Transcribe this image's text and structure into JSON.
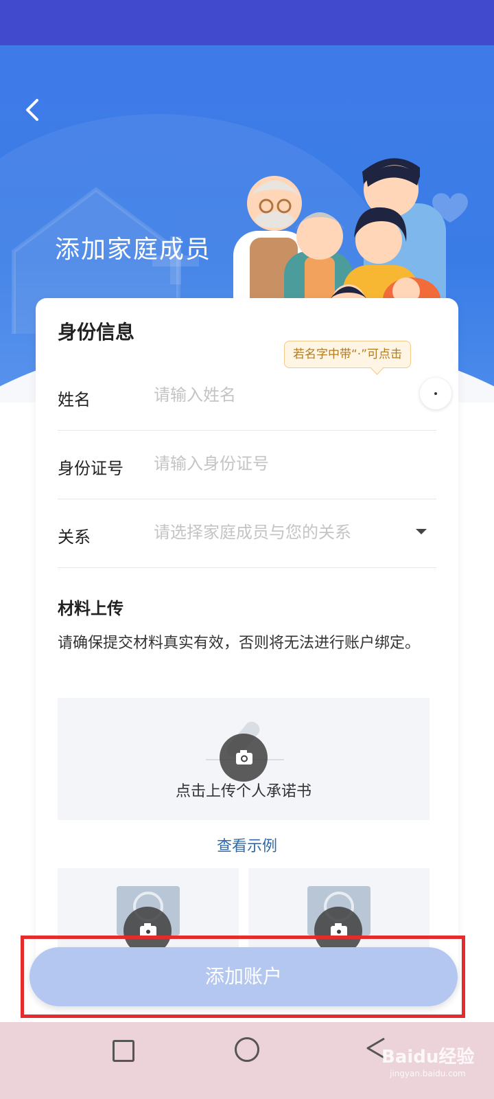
{
  "header": {
    "title": "添加家庭成员"
  },
  "form": {
    "section_title": "身份信息",
    "tooltip": "若名字中带“·”可点击",
    "name": {
      "label": "姓名",
      "placeholder": "请输入姓名"
    },
    "id_number": {
      "label": "身份证号",
      "placeholder": "请输入身份证号"
    },
    "relation": {
      "label": "关系",
      "placeholder": "请选择家庭成员与您的关系"
    }
  },
  "materials": {
    "section_title": "材料上传",
    "note": "请确保提交材料真实有效，否则将无法进行账户绑定。",
    "upload_label": "点击上传个人承诺书",
    "example_link": "查看示例"
  },
  "submit": {
    "label": "添加账户"
  },
  "watermark": {
    "brand": "Baidu经验",
    "url": "jingyan.baidu.com"
  },
  "colors": {
    "status_bar": "#4149cd",
    "hero_blue": "#3f7be8",
    "submit_disabled": "#b4c7f0",
    "highlight_border": "#e42c2c",
    "tooltip_text": "#b27a1e",
    "link": "#2f6aa8"
  },
  "icons": {
    "back": "chevron-left-icon",
    "dot": "middle-dot-icon",
    "dropdown": "caret-down-icon",
    "camera": "camera-icon",
    "nav_recent": "square-icon",
    "nav_home": "circle-icon",
    "nav_back": "triangle-back-icon"
  }
}
